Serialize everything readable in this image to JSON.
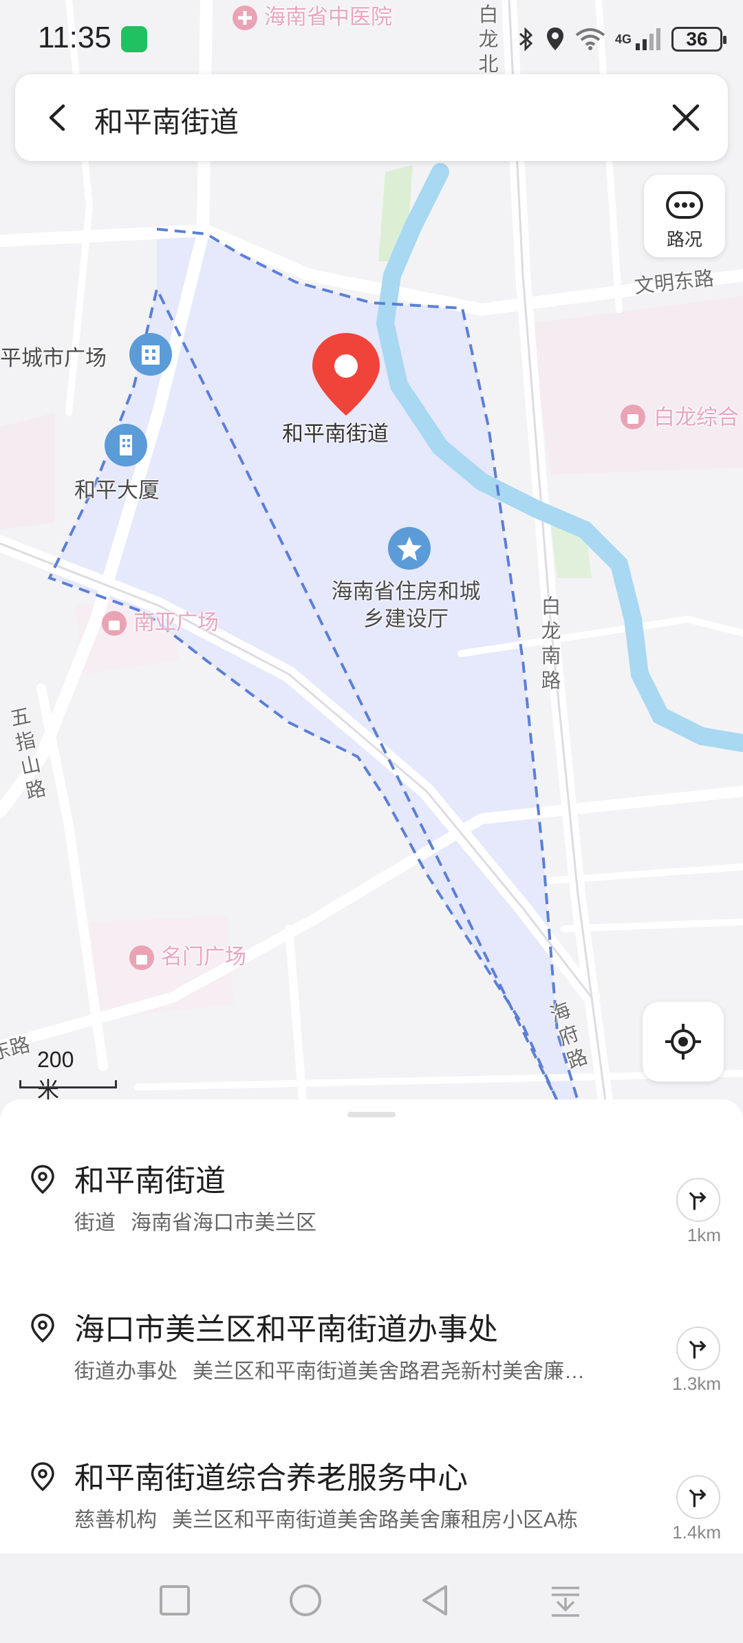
{
  "status_bar": {
    "time": "11:35",
    "network": "4G",
    "battery": "36"
  },
  "search": {
    "query": "和平南街道"
  },
  "traffic_button": {
    "label": "路况"
  },
  "map": {
    "scale_label": "200米",
    "selected_marker_label": "和平南街道",
    "labels": {
      "hospital": "海南省中医院",
      "bailong_north": "白龙北",
      "wenming_east_road": "文明东路",
      "city_plaza": "平城市广场",
      "bailong_complex": "白龙综合",
      "heping_building": "和平大厦",
      "housing_dept": "海南省住房和城乡建设厅",
      "nanya_plaza": "南亚广场",
      "bailong_south_road": "白龙南路",
      "wuzhishan_road": "五指山路",
      "mingmen_plaza": "名门广场",
      "haifu_road": "海府路",
      "road_left_bottom": "东路"
    }
  },
  "results": [
    {
      "title": "和平南街道",
      "category": "街道",
      "address": "海南省海口市美兰区",
      "distance": "1km"
    },
    {
      "title": "海口市美兰区和平南街道办事处",
      "category": "街道办事处",
      "address": "美兰区和平南街道美舍路君尧新村美舍廉…",
      "distance": "1.3km"
    },
    {
      "title": "和平南街道综合养老服务中心",
      "category": "慈善机构",
      "address": "美兰区和平南街道美舍路美舍廉租房小区A栋",
      "distance": "1.4km"
    }
  ],
  "colors": {
    "marker": "#f0443a",
    "boundary": "#5b7fd6",
    "district_fill": "#e6e8fb",
    "river": "#a8d8f2",
    "poi_blue": "#5b9bd8",
    "poi_pink": "#e8a6c0"
  }
}
